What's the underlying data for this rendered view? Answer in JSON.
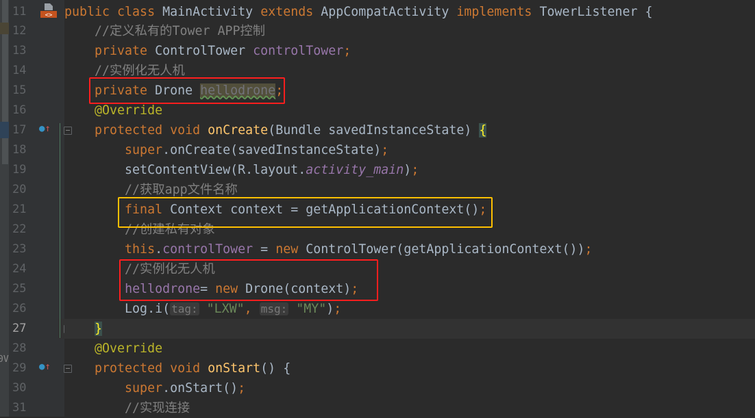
{
  "editor": {
    "line_numbers": [
      "11",
      "12",
      "13",
      "14",
      "15",
      "16",
      "17",
      "18",
      "19",
      "20",
      "21",
      "22",
      "23",
      "24",
      "25",
      "26",
      "27",
      "28",
      "29",
      "30",
      "31"
    ],
    "current_line": "27",
    "side_label": "0V",
    "lines": [
      [
        [
          "public class ",
          "kw"
        ],
        [
          "MainActivity ",
          ""
        ],
        [
          "extends ",
          "kw"
        ],
        [
          "AppCompatActivity ",
          ""
        ],
        [
          "implements ",
          "kw"
        ],
        [
          "TowerListener {",
          ""
        ]
      ],
      [
        [
          "    //定义私有的Tower APP控制",
          "cm"
        ]
      ],
      [
        [
          "    private ",
          "kw"
        ],
        [
          "ControlTower ",
          ""
        ],
        [
          "controlTower",
          "fd"
        ],
        [
          ";",
          "kw"
        ]
      ],
      [
        [
          "    //实例化无人机",
          "cm"
        ]
      ],
      [
        [
          "    private ",
          "kw"
        ],
        [
          "Drone ",
          ""
        ],
        [
          "hellodrone",
          "unused"
        ],
        [
          ";",
          "kw"
        ]
      ],
      [
        [
          "    @Override",
          "an"
        ]
      ],
      [
        [
          "    protected void ",
          "kw"
        ],
        [
          "onCreate",
          "fn"
        ],
        [
          "(Bundle savedInstanceState) ",
          ""
        ],
        [
          "{",
          "br"
        ]
      ],
      [
        [
          "        super",
          "kw"
        ],
        [
          ".onCreate(savedInstanceState)",
          ""
        ],
        [
          ";",
          "kw"
        ]
      ],
      [
        [
          "        setContentView(R.layout.",
          ""
        ],
        [
          "activity_main",
          "sf"
        ],
        [
          ")",
          ""
        ],
        [
          ";",
          "kw"
        ]
      ],
      [
        [
          "        //获取app文件名称",
          "cm"
        ]
      ],
      [
        [
          "        final ",
          "kw"
        ],
        [
          "Context context = getApplicationContext()",
          ""
        ],
        [
          ";",
          "kw"
        ]
      ],
      [
        [
          "        //创建私有对象",
          "cm"
        ]
      ],
      [
        [
          "        this",
          "kw"
        ],
        [
          ".",
          ""
        ],
        [
          "controlTower",
          "fd"
        ],
        [
          " = ",
          ""
        ],
        [
          "new ",
          "kw"
        ],
        [
          "ControlTower(getApplicationContext())",
          ""
        ],
        [
          ";",
          "kw"
        ]
      ],
      [
        [
          "        //实例化无人机",
          "cm"
        ]
      ],
      [
        [
          "        ",
          ""
        ],
        [
          "hellodrone",
          "fd"
        ],
        [
          "= ",
          ""
        ],
        [
          "new ",
          "kw"
        ],
        [
          "Drone(context)",
          ""
        ],
        [
          ";",
          "kw"
        ]
      ],
      [
        [
          "        Log.i(",
          ""
        ],
        [
          "tag:",
          "hint"
        ],
        [
          " ",
          ""
        ],
        [
          "\"LXW\"",
          "st"
        ],
        [
          ", ",
          "kw"
        ],
        [
          "msg:",
          "hint"
        ],
        [
          " ",
          ""
        ],
        [
          "\"MY\"",
          "st"
        ],
        [
          ")",
          ""
        ],
        [
          ";",
          "kw"
        ]
      ],
      [
        [
          "    ",
          ""
        ],
        [
          "}",
          "br"
        ]
      ],
      [
        [
          "    @Override",
          "an"
        ]
      ],
      [
        [
          "    protected void ",
          "kw"
        ],
        [
          "onStart",
          "fn"
        ],
        [
          "() {",
          ""
        ]
      ],
      [
        [
          "        super",
          "kw"
        ],
        [
          ".onStart()",
          ""
        ],
        [
          ";",
          "kw"
        ]
      ],
      [
        [
          "        //实现连接",
          "cm"
        ]
      ]
    ]
  },
  "annotations": {
    "red": "#ff1e1e",
    "yellow": "#ffc000"
  },
  "icons": [
    "class-file-icon",
    "override-method-icon",
    "fold-toggle-icon"
  ]
}
